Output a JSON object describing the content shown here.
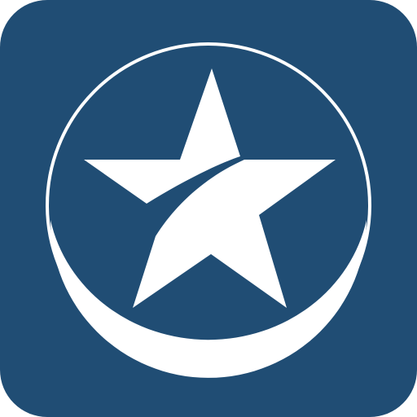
{
  "icon": {
    "name": "star-badge-app-icon",
    "colors": {
      "background": "#204d74",
      "foreground": "#ffffff",
      "canvas": "#ffffff"
    }
  }
}
